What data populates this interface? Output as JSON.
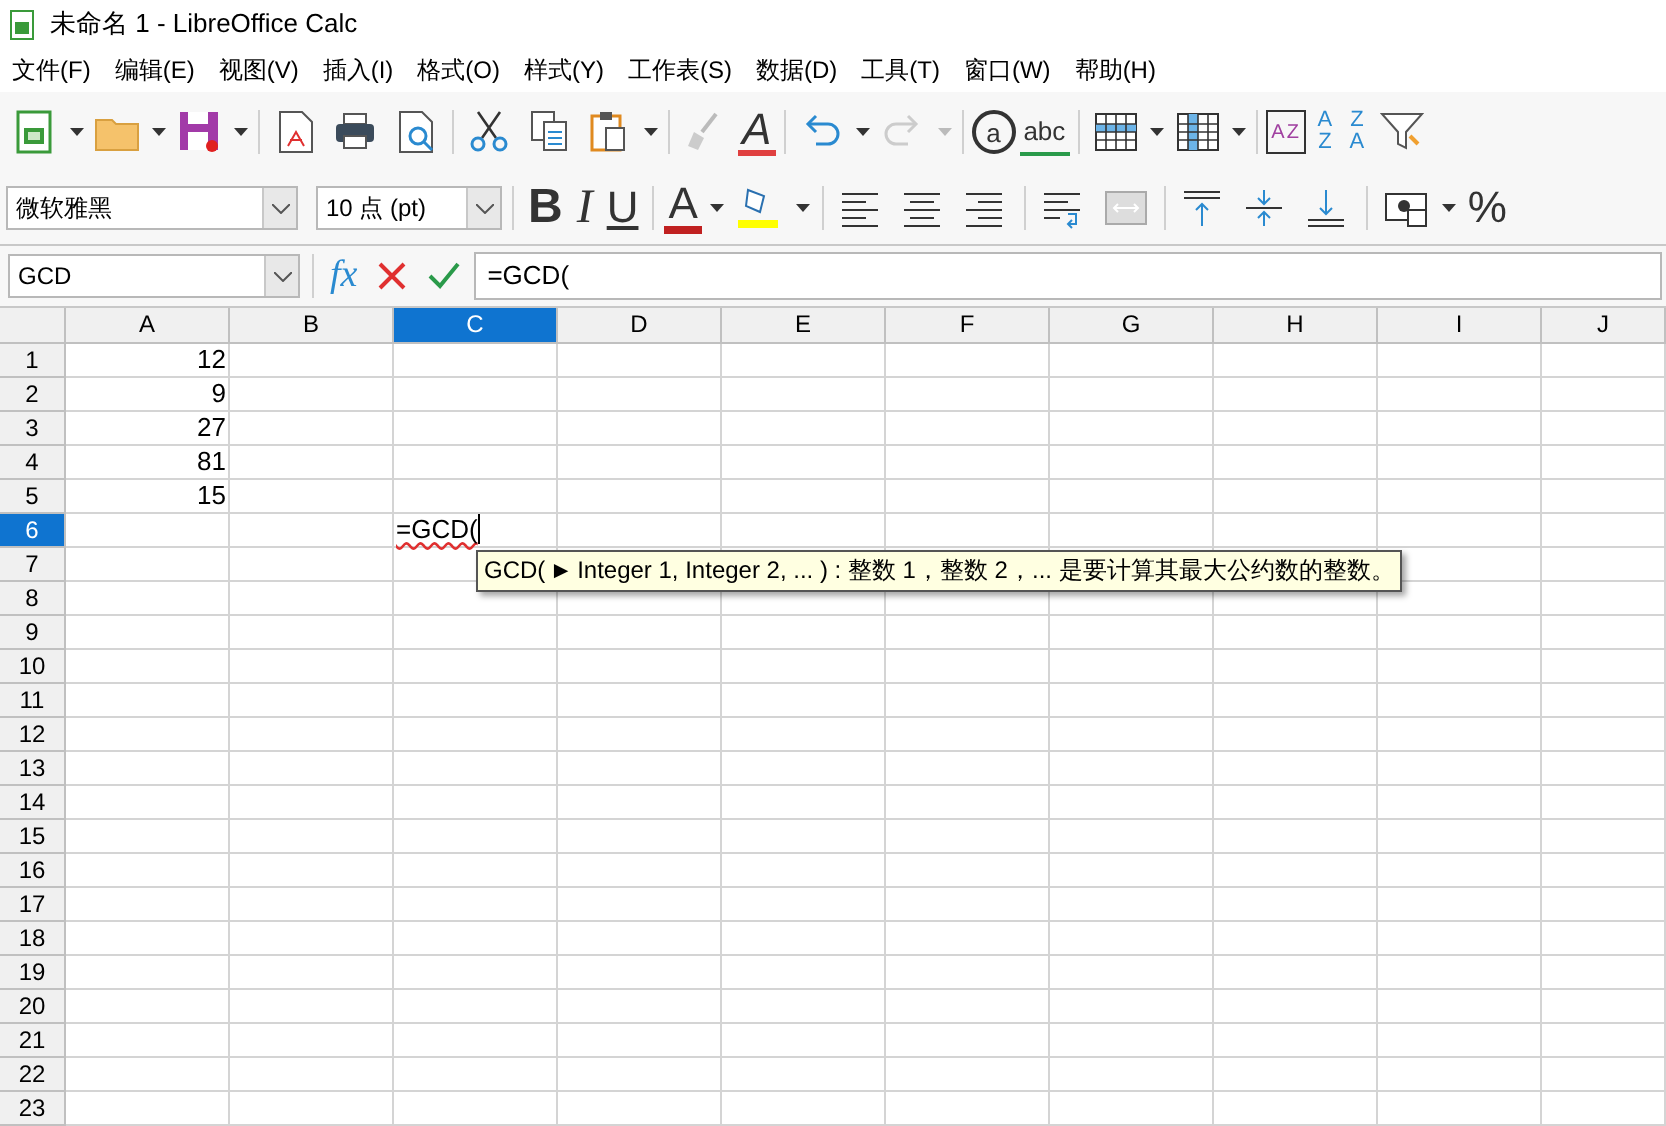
{
  "window": {
    "title": "未命名 1 - LibreOffice Calc"
  },
  "menu": [
    "文件(F)",
    "编辑(E)",
    "视图(V)",
    "插入(I)",
    "格式(O)",
    "样式(Y)",
    "工作表(S)",
    "数据(D)",
    "工具(T)",
    "窗口(W)",
    "帮助(H)"
  ],
  "standard_toolbar": [
    {
      "kind": "new"
    },
    {
      "kind": "caret"
    },
    {
      "kind": "open"
    },
    {
      "kind": "caret"
    },
    {
      "kind": "save"
    },
    {
      "kind": "caret"
    },
    {
      "kind": "sep"
    },
    {
      "kind": "pdf"
    },
    {
      "kind": "print"
    },
    {
      "kind": "preview"
    },
    {
      "kind": "sep"
    },
    {
      "kind": "cut"
    },
    {
      "kind": "copy"
    },
    {
      "kind": "paste"
    },
    {
      "kind": "caret"
    },
    {
      "kind": "sep"
    },
    {
      "kind": "clone"
    },
    {
      "kind": "clear",
      "glyph": "A"
    },
    {
      "kind": "sep"
    },
    {
      "kind": "undo"
    },
    {
      "kind": "caret"
    },
    {
      "kind": "redo"
    },
    {
      "kind": "caret-grey"
    },
    {
      "kind": "sep"
    },
    {
      "kind": "find",
      "glyph": "a"
    },
    {
      "kind": "spell",
      "glyph": "abc"
    },
    {
      "kind": "sep"
    },
    {
      "kind": "rows"
    },
    {
      "kind": "caret"
    },
    {
      "kind": "cols"
    },
    {
      "kind": "caret"
    },
    {
      "kind": "sep"
    },
    {
      "kind": "sort",
      "glyph": "AZ"
    },
    {
      "kind": "sortasc",
      "glyph": "AZ"
    },
    {
      "kind": "sortdesc",
      "glyph": "ZA"
    },
    {
      "kind": "filter"
    }
  ],
  "format_toolbar": {
    "font_name": "微软雅黑",
    "font_size": "10 点 (pt)",
    "items": [
      {
        "kind": "sep"
      },
      {
        "kind": "bold",
        "glyph": "B"
      },
      {
        "kind": "italic",
        "glyph": "I"
      },
      {
        "kind": "underline",
        "glyph": "U"
      },
      {
        "kind": "sep"
      },
      {
        "kind": "fontcolor",
        "glyph": "A"
      },
      {
        "kind": "caret"
      },
      {
        "kind": "highlight"
      },
      {
        "kind": "caret"
      },
      {
        "kind": "sep"
      },
      {
        "kind": "left"
      },
      {
        "kind": "center"
      },
      {
        "kind": "right"
      },
      {
        "kind": "sep"
      },
      {
        "kind": "wrap"
      },
      {
        "kind": "merge"
      },
      {
        "kind": "sep"
      },
      {
        "kind": "top"
      },
      {
        "kind": "vcenter"
      },
      {
        "kind": "bottom"
      },
      {
        "kind": "sep"
      },
      {
        "kind": "currency"
      },
      {
        "kind": "caret"
      },
      {
        "kind": "percent",
        "glyph": "%"
      }
    ]
  },
  "formula_bar": {
    "name_box": "GCD",
    "function_glyph": "fx",
    "input": "=GCD("
  },
  "columns": [
    {
      "label": "A",
      "selected": false
    },
    {
      "label": "B",
      "selected": false
    },
    {
      "label": "C",
      "selected": true
    },
    {
      "label": "D",
      "selected": false
    },
    {
      "label": "E",
      "selected": false
    },
    {
      "label": "F",
      "selected": false
    },
    {
      "label": "G",
      "selected": false
    },
    {
      "label": "H",
      "selected": false
    },
    {
      "label": "I",
      "selected": false
    },
    {
      "label": "J",
      "selected": false
    }
  ],
  "rows": [
    {
      "number": "1",
      "selected": false,
      "cells": {
        "A": {
          "kind": "number",
          "text": "12"
        }
      }
    },
    {
      "number": "2",
      "selected": false,
      "cells": {
        "A": {
          "kind": "number",
          "text": "9"
        }
      }
    },
    {
      "number": "3",
      "selected": false,
      "cells": {
        "A": {
          "kind": "number",
          "text": "27"
        }
      }
    },
    {
      "number": "4",
      "selected": false,
      "cells": {
        "A": {
          "kind": "number",
          "text": "81"
        }
      }
    },
    {
      "number": "5",
      "selected": false,
      "cells": {
        "A": {
          "kind": "number",
          "text": "15"
        }
      }
    },
    {
      "number": "6",
      "selected": true,
      "cells": {
        "C": {
          "kind": "editing",
          "text": "=GCD("
        }
      }
    },
    {
      "number": "7",
      "selected": false
    },
    {
      "number": "8",
      "selected": false
    },
    {
      "number": "9",
      "selected": false
    },
    {
      "number": "10",
      "selected": false
    },
    {
      "number": "11",
      "selected": false
    },
    {
      "number": "12",
      "selected": false
    },
    {
      "number": "13",
      "selected": false
    },
    {
      "number": "14",
      "selected": false
    },
    {
      "number": "15",
      "selected": false
    },
    {
      "number": "16",
      "selected": false
    },
    {
      "number": "17",
      "selected": false
    },
    {
      "number": "18",
      "selected": false
    },
    {
      "number": "19",
      "selected": false
    },
    {
      "number": "20",
      "selected": false
    },
    {
      "number": "21",
      "selected": false
    },
    {
      "number": "22",
      "selected": false
    },
    {
      "number": "23",
      "selected": false
    }
  ],
  "tooltip": {
    "function": "GCD(",
    "marker": "►",
    "text": "Integer 1, Integer 2, ...  ) : 整数 1，整数 2，... 是要计算其最大公约数的整数。"
  }
}
